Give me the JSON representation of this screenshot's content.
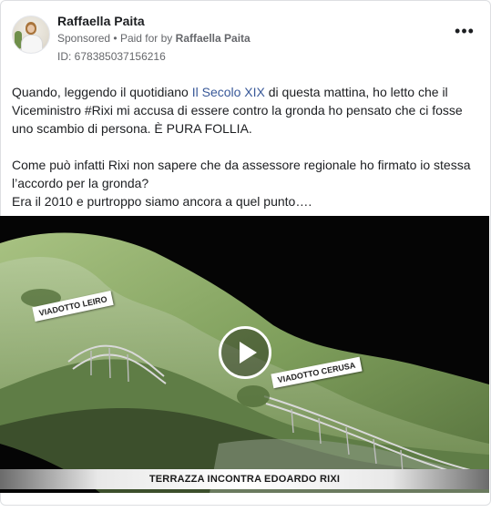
{
  "post": {
    "author": "Raffaella Paita",
    "sponsored": "Sponsored",
    "separator": "•",
    "paid_for": "Paid for by",
    "paid_by": "Raffaella Paita",
    "ad_id": "ID: 678385037156216",
    "more_label": "•••"
  },
  "body": {
    "p1_before": "Quando, leggendo il quotidiano ",
    "p1_link": "Il Secolo XIX",
    "p1_after": " di questa mattina, ho letto che il Viceministro #Rixi mi accusa di essere contro la gronda ho pensato che ci fosse uno scambio di persona. È PURA FOLLIA.",
    "p2": "Come può infatti Rixi non sapere che da assessore regionale ho firmato io stessa l’accordo per la gronda?",
    "p3": "Era il 2010 e purtroppo siamo ancora a quel punto…."
  },
  "video": {
    "label_left": "VIADOTTO LEIRO",
    "label_right": "VIADOTTO CERUSA",
    "caption": "TERRAZZA INCONTRA EDOARDO RIXI"
  },
  "colors": {
    "link": "#385898",
    "meta": "#65676b",
    "terrain_dark": "#5d7d45",
    "terrain_light": "#9bb873"
  }
}
